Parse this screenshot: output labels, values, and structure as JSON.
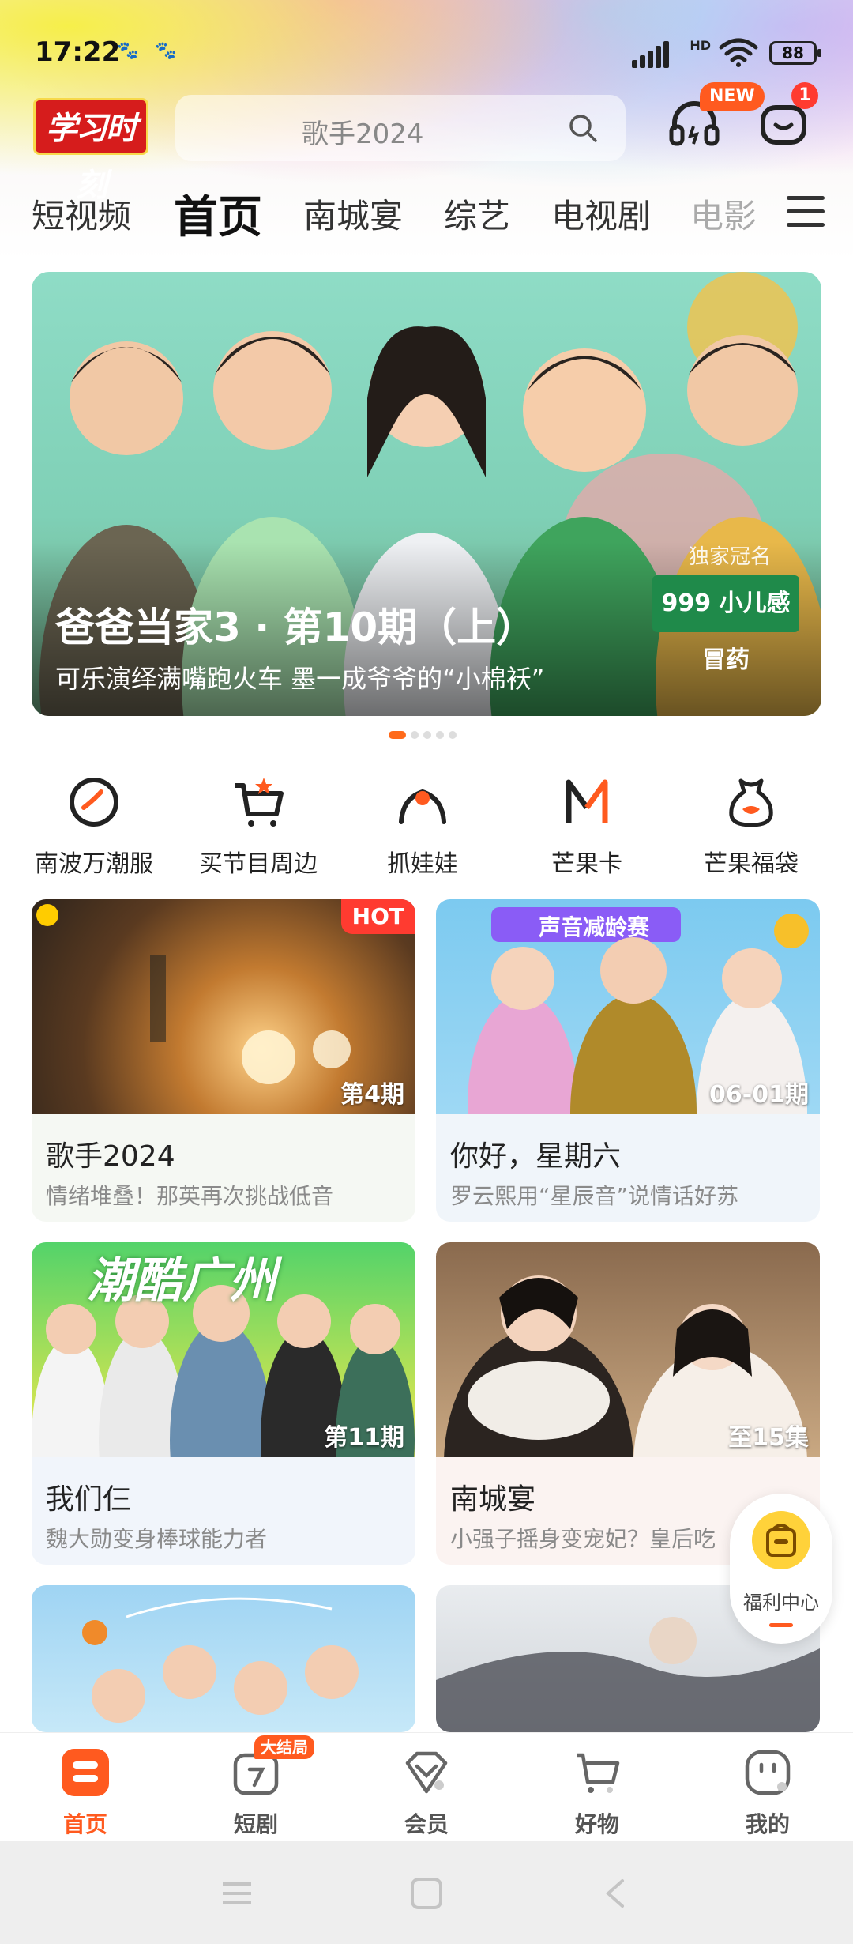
{
  "status": {
    "time": "17:22",
    "battery": "88",
    "network": "HD"
  },
  "header": {
    "logo_text": "学习时刻",
    "search_placeholder": "歌手2024",
    "new_badge": "NEW",
    "message_count": "1"
  },
  "tabs": [
    {
      "label": "短视频"
    },
    {
      "label": "首页",
      "active": true
    },
    {
      "label": "南城宴"
    },
    {
      "label": "综艺"
    },
    {
      "label": "电视剧"
    },
    {
      "label": "电影"
    }
  ],
  "banner": {
    "title": "爸爸当家3 · 第10期（上）",
    "subtitle": "可乐演绎满嘴跑火车 墨一成爷爷的“小棉袄”",
    "sponsor_label": "独家冠名",
    "sponsor_name": "999 小儿感冒药",
    "page_count": 5,
    "active_page": 0
  },
  "quick_links": [
    {
      "label": "南波万潮服",
      "icon": "circle-swoosh-icon"
    },
    {
      "label": "买节目周边",
      "icon": "cart-star-icon"
    },
    {
      "label": "抓娃娃",
      "icon": "claw-icon"
    },
    {
      "label": "芒果卡",
      "icon": "m-card-icon"
    },
    {
      "label": "芒果福袋",
      "icon": "lucky-bag-icon"
    }
  ],
  "cards": [
    {
      "title": "歌手2024",
      "subtitle": "情绪堆叠！那英再次挑战低音",
      "episode": "第4期",
      "badge": "HOT"
    },
    {
      "title": "你好，星期六",
      "subtitle": "罗云熙用“星辰音”说情话好苏",
      "episode": "06-01期",
      "thumb_text": "声音减龄赛"
    },
    {
      "title": "我们仨",
      "subtitle": "魏大勋变身棒球能力者",
      "episode": "第11期",
      "thumb_text": "潮酷广州"
    },
    {
      "title": "南城宴",
      "subtitle": "小强子摇身变宠妃？皇后吃",
      "episode": "至15集"
    }
  ],
  "welfare": {
    "label": "福利中心"
  },
  "bottom_nav": [
    {
      "label": "首页",
      "active": true
    },
    {
      "label": "短剧",
      "badge": "大结局"
    },
    {
      "label": "会员"
    },
    {
      "label": "好物"
    },
    {
      "label": "我的"
    }
  ],
  "colors": {
    "accent": "#ff5a1f",
    "hot": "#ff3b30",
    "logo": "#d61c1c"
  }
}
